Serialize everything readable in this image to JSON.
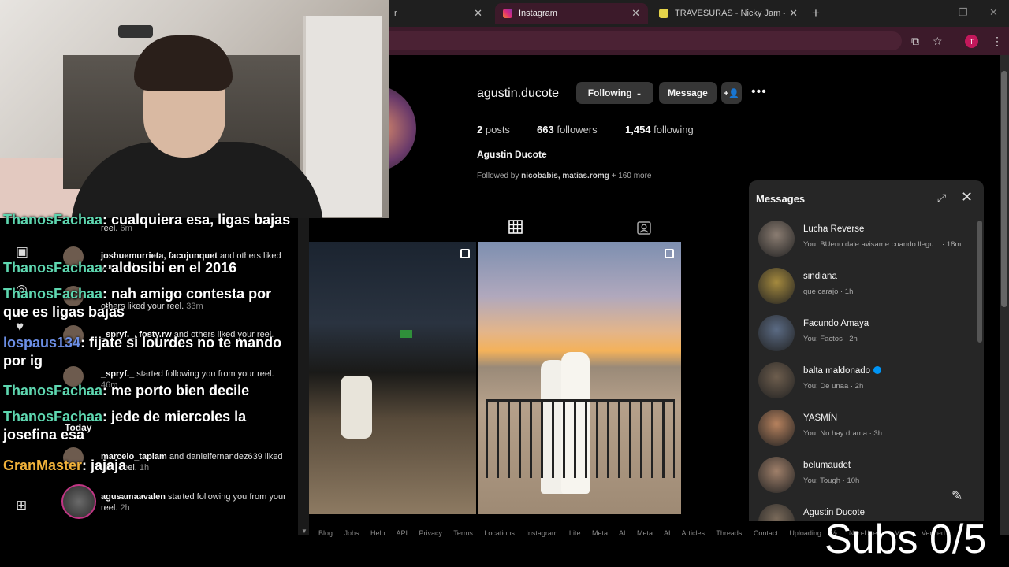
{
  "browser": {
    "tabs": [
      {
        "label": "r",
        "active": false
      },
      {
        "label": "Instagram",
        "active": true
      },
      {
        "label": "TRAVESURAS - Nicky Jam - LET",
        "active": false
      }
    ],
    "new_tab": "+",
    "profile_initial": "T"
  },
  "profile": {
    "username": "agustin.ducote",
    "following_label": "Following",
    "message_label": "Message",
    "posts_count": "2",
    "posts_label": "posts",
    "followers_count": "663",
    "followers_label": "followers",
    "following_count": "1,454",
    "following_label2": "following",
    "full_name": "Agustin Ducote",
    "followed_by_prefix": "Followed by",
    "followed_by_users": "nicobabis, matias.romg",
    "followed_by_more": "+ 160 more"
  },
  "footer": "Blog Jobs Help API Privacy Terms Locations Instagram Lite Meta AI Meta AI Articles Threads Contact Uploading & Non-Users Meta Verified",
  "messages": {
    "title": "Messages",
    "threads": [
      {
        "name": "Lucha Reverse",
        "preview": "You: BUeno dale avisame cuando llegu... · 18m",
        "color": "#8b7d72"
      },
      {
        "name": "sindiana",
        "preview": "que carajo · 1h",
        "color": "#a58a3e"
      },
      {
        "name": "Facundo Amaya",
        "preview": "You: Factos · 2h",
        "color": "#5b6b84"
      },
      {
        "name": "balta maldonado",
        "preview": "You: De unaa · 2h",
        "color": "#6e5e4e",
        "verified": true
      },
      {
        "name": "YASMÍN",
        "preview": "You: No hay drama · 3h",
        "color": "#b7825e"
      },
      {
        "name": "belumaudet",
        "preview": "You: Tough · 10h",
        "color": "#a0806a"
      },
      {
        "name": "Agustin Ducote",
        "preview": "",
        "color": "#7a6a5a"
      }
    ]
  },
  "notifications": {
    "today_label": "Today",
    "items": [
      {
        "text": "reel.",
        "time": "6m"
      },
      {
        "users": "joshuemurrieta, facujunquet",
        "text": "and others liked your reel.",
        "time": ""
      },
      {
        "users": "",
        "text": "others liked your reel.",
        "time": "33m"
      },
      {
        "users": "_spryf._, fosty.rw",
        "text": "and others liked your reel.",
        "time": ""
      },
      {
        "users": "_spryf._",
        "text": "started following you from your reel.",
        "time": "46m"
      },
      {
        "users": "marcelo_tapiam",
        "text": "and danielfernandez639 liked your reel.",
        "time": "1h"
      },
      {
        "users": "agusamaavalen",
        "text": "started following you from your reel.",
        "time": "2h"
      }
    ]
  },
  "chat": [
    {
      "user": "ThanosFachaa",
      "msg": ": cualquiera esa, ligas bajas"
    },
    {
      "user": "ThanosFachaa",
      "msg": ": aldosibi en el 2016"
    },
    {
      "user": "ThanosFachaa",
      "msg": ": nah amigo contesta por que es ligas bajas"
    },
    {
      "user": "lospaus134",
      "msg": ": fijate si lourdes no te mando por ig"
    },
    {
      "user": "ThanosFachaa",
      "msg": ": me porto bien decile"
    },
    {
      "user": "ThanosFachaa",
      "msg": ": jede de miercoles la josefina esa"
    },
    {
      "user": "GranMaster",
      "msg": ": jajaja"
    }
  ],
  "overlay": {
    "subs": "Subs 0/5"
  }
}
